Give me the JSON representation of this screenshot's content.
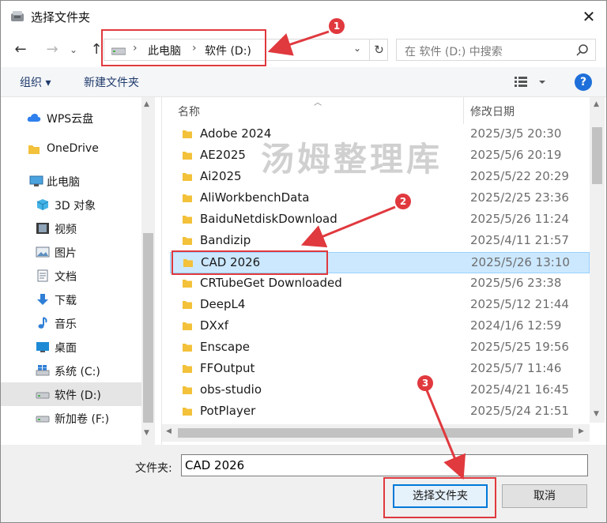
{
  "window": {
    "title": "选择文件夹",
    "close_symbol": "✕"
  },
  "nav": {
    "back_symbol": "←",
    "forward_symbol": "→",
    "recent_symbol": "⌄",
    "up_symbol": "↑",
    "address": {
      "sep": "›",
      "crumbs": [
        "此电脑",
        "软件 (D:)"
      ],
      "dropdown_symbol": "⌄",
      "refresh_symbol": "↻"
    },
    "search_placeholder": "在 软件 (D:) 中搜索"
  },
  "toolbar": {
    "organize_label": "组织 ▾",
    "new_folder_label": "新建文件夹",
    "help_label": "?"
  },
  "sidebar": {
    "items": [
      {
        "label": "WPS云盘",
        "icon": "cloud-icon"
      },
      {
        "label": "OneDrive",
        "icon": "folder-icon"
      },
      {
        "label": "此电脑",
        "icon": "computer-icon"
      },
      {
        "label": "3D 对象",
        "icon": "cube-icon"
      },
      {
        "label": "视频",
        "icon": "video-icon"
      },
      {
        "label": "图片",
        "icon": "picture-icon"
      },
      {
        "label": "文档",
        "icon": "document-icon"
      },
      {
        "label": "下载",
        "icon": "download-icon"
      },
      {
        "label": "音乐",
        "icon": "music-icon"
      },
      {
        "label": "桌面",
        "icon": "desktop-icon"
      },
      {
        "label": "系统 (C:)",
        "icon": "windows-drive-icon"
      },
      {
        "label": "软件 (D:)",
        "icon": "drive-icon",
        "selected": true
      },
      {
        "label": "新加卷 (F:)",
        "icon": "drive-icon"
      }
    ]
  },
  "filelist": {
    "columns": {
      "name": "名称",
      "date": "修改日期"
    },
    "rows": [
      {
        "name": "Adobe 2024",
        "date": "2025/3/5 20:30"
      },
      {
        "name": "AE2025",
        "date": "2025/5/6 20:19"
      },
      {
        "name": "Ai2025",
        "date": "2025/5/22 20:29"
      },
      {
        "name": "AliWorkbenchData",
        "date": "2025/2/25 23:36"
      },
      {
        "name": "BaiduNetdiskDownload",
        "date": "2025/5/26 11:24"
      },
      {
        "name": "Bandizip",
        "date": "2025/4/11 21:57"
      },
      {
        "name": "CAD 2026",
        "date": "2025/5/26 13:10",
        "selected": true
      },
      {
        "name": "CRTubeGet Downloaded",
        "date": "2025/5/6 23:38"
      },
      {
        "name": "DeepL4",
        "date": "2025/5/12 21:44"
      },
      {
        "name": "DXxf",
        "date": "2024/1/6 12:59"
      },
      {
        "name": "Enscape",
        "date": "2025/5/25 19:56"
      },
      {
        "name": "FFOutput",
        "date": "2025/5/7 11:46"
      },
      {
        "name": "obs-studio",
        "date": "2025/4/21 16:45"
      },
      {
        "name": "PotPlayer",
        "date": "2025/5/24 21:51"
      }
    ]
  },
  "bottom": {
    "folder_label": "文件夹:",
    "folder_value": "CAD 2026",
    "select_button": "选择文件夹",
    "cancel_button": "取消"
  },
  "annotations": {
    "badges": [
      "1",
      "2",
      "3"
    ],
    "watermark": "汤姆整理库",
    "color": "#e0393e"
  },
  "colors": {
    "selection_bg": "#cce8ff",
    "accent": "#0078d7",
    "help_blue": "#1e6fd9",
    "folder_yellow": "#f3c13a"
  }
}
